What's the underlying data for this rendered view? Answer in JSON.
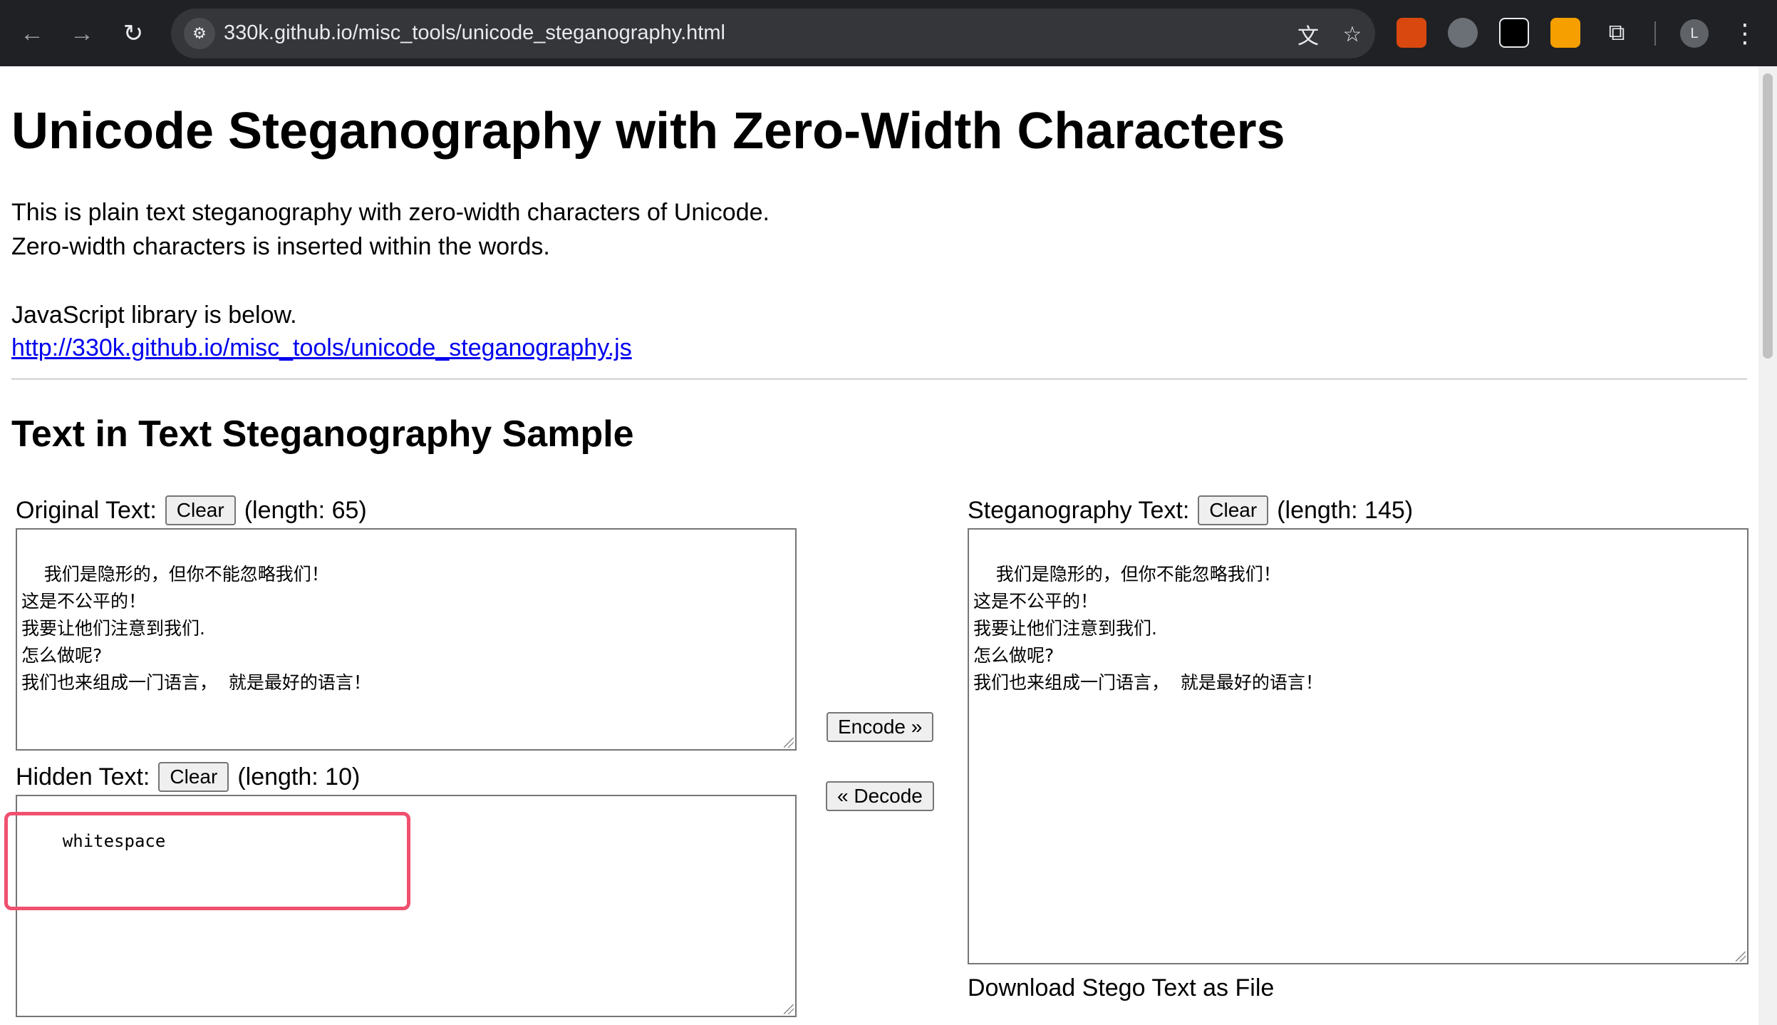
{
  "browser": {
    "back_icon": "←",
    "forward_icon": "→",
    "reload_icon": "↻",
    "site_info_icon": "⚙",
    "url": "330k.github.io/misc_tools/unicode_steganography.html",
    "translate_icon": "文",
    "bookmark_icon": "☆",
    "extensions_icon": "⧉",
    "menu_icon": "⋮",
    "profile_initial": "L"
  },
  "page": {
    "title": "Unicode Steganography with Zero-Width Characters",
    "intro_line1": "This is plain text steganography with zero-width characters of Unicode.",
    "intro_line2": "Zero-width characters is inserted within the words.",
    "library_label": "JavaScript library is below.",
    "library_link": "http://330k.github.io/misc_tools/unicode_steganography.js",
    "section_title": "Text in Text Steganography Sample"
  },
  "original": {
    "label": "Original Text:",
    "clear_label": "Clear",
    "length_text": "(length: 65)",
    "value": "我们是隐形的，但你不能忽略我们！\n这是不公平的！\n我要让他们注意到我们.\n怎么做呢?\n我们也来组成一门语言，  就是最好的语言！"
  },
  "hidden": {
    "label": "Hidden Text:",
    "clear_label": "Clear",
    "length_text": "(length: 10)",
    "value": "whitespace"
  },
  "actions": {
    "encode_label": "Encode »",
    "decode_label": "« Decode"
  },
  "stego": {
    "label": "Steganography Text:",
    "clear_label": "Clear",
    "length_text": "(length: 145)",
    "value": "我们是隐形的，但你不能忽略我们！\n这是不公平的！\n我要让他们注意到我们.\n怎么做呢?\n我们也来组成一门语言，  就是最好的语言！",
    "download_label": "Download Stego Text as File"
  },
  "colors": {
    "highlight": "#f0506e",
    "link": "#0000ee",
    "chrome_bg": "#202124"
  }
}
